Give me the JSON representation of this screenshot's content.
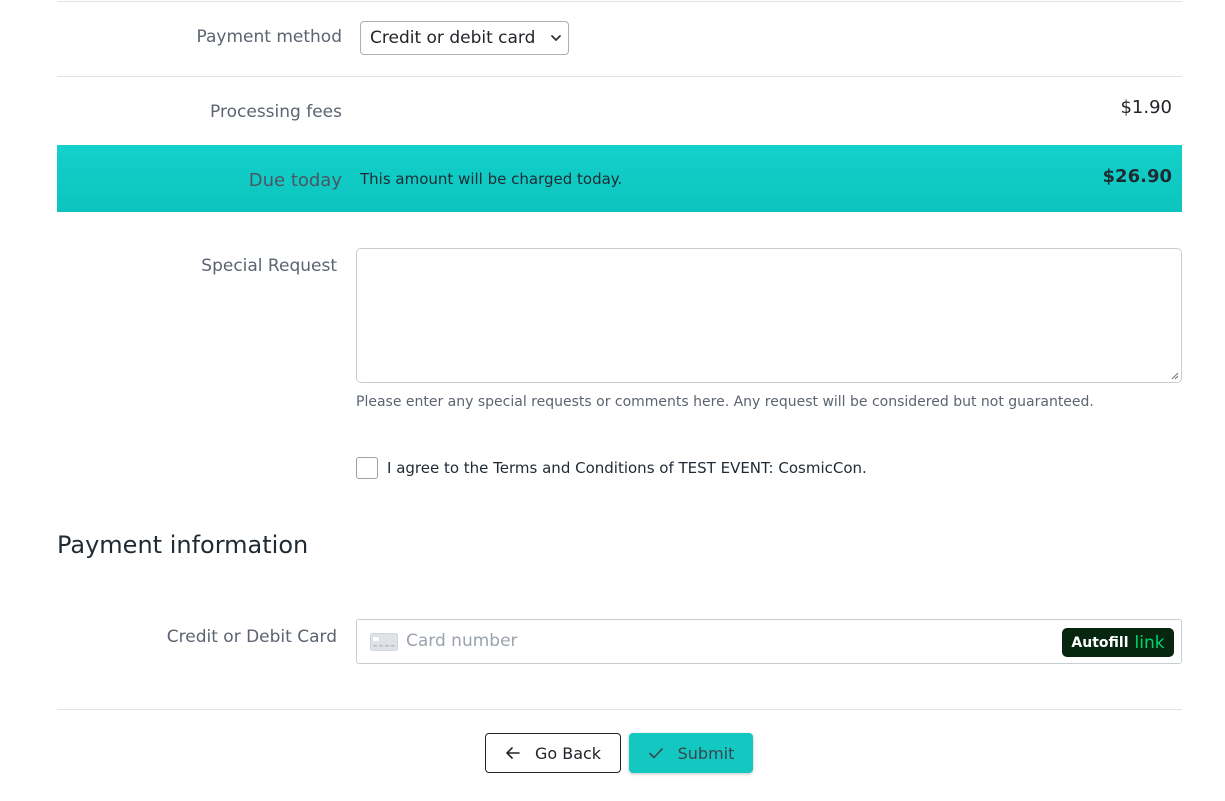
{
  "payment_method": {
    "label": "Payment method",
    "selected": "Credit or debit card"
  },
  "fees": {
    "label": "Processing fees",
    "amount": "$1.90"
  },
  "due": {
    "label": "Due today",
    "note": "This amount will be charged today.",
    "amount": "$26.90"
  },
  "special_request": {
    "label": "Special Request",
    "value": "",
    "help": "Please enter any special requests or comments here. Any request will be considered but not guaranteed."
  },
  "terms": {
    "label": "I agree to the Terms and Conditions of TEST EVENT: CosmicCon.",
    "checked": false
  },
  "payment_info": {
    "title": "Payment information",
    "card_label": "Credit or Debit Card",
    "card_placeholder": "Card number",
    "autofill_label": "Autofill",
    "autofill_brand": "link"
  },
  "buttons": {
    "back_label": "Go Back",
    "submit_label": "Submit"
  },
  "colors": {
    "accent": "#13c8c1",
    "link_green": "#00d66f",
    "link_bg": "#06260f"
  }
}
